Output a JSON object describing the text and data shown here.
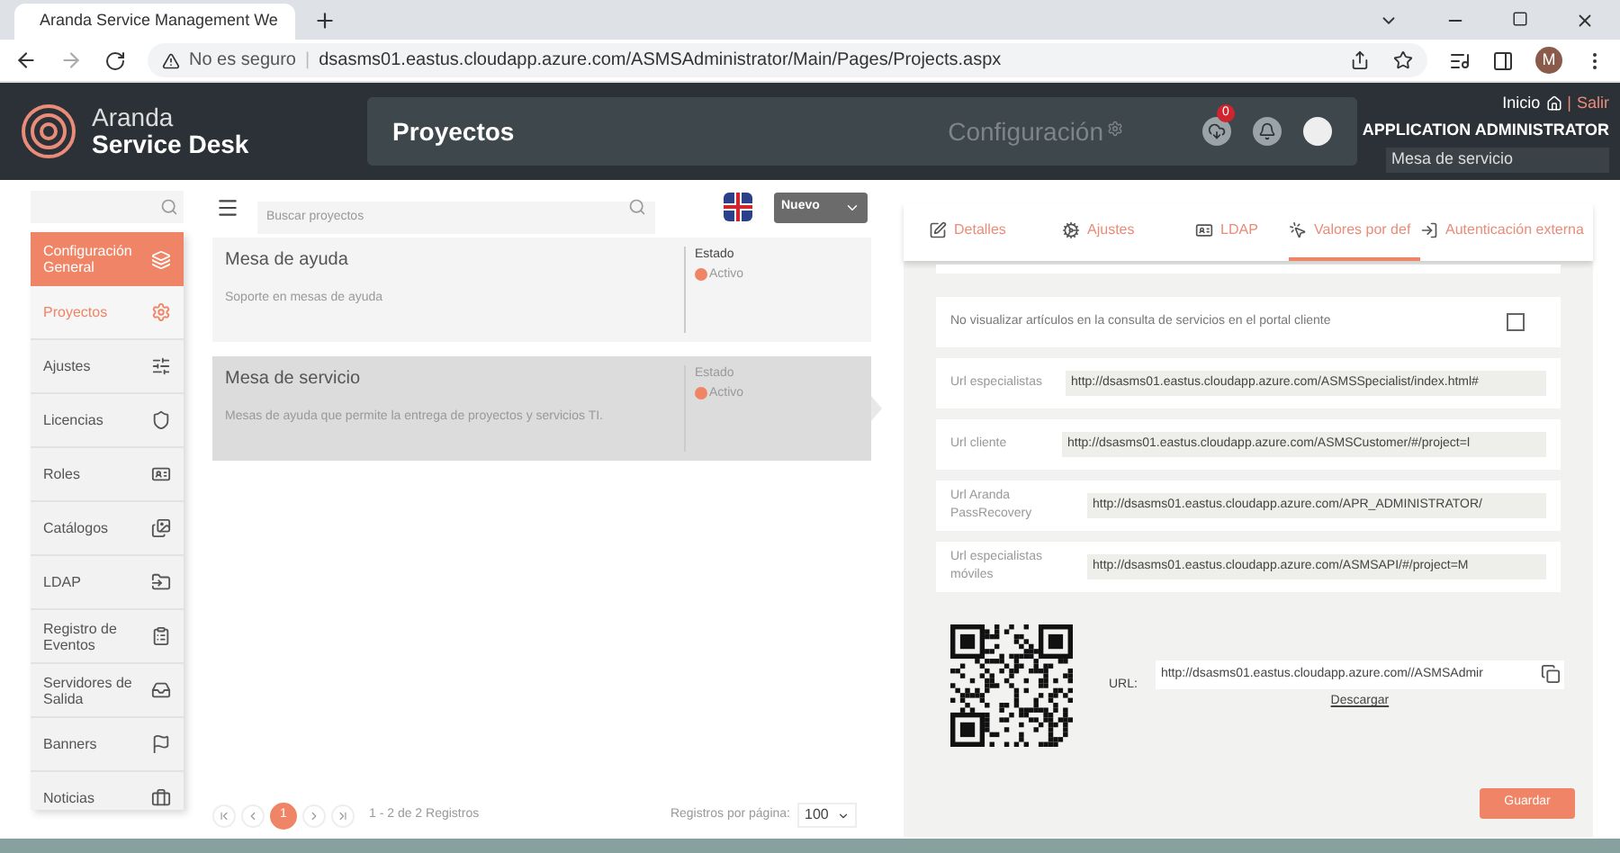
{
  "browser": {
    "tab_title": "Aranda Service Management We",
    "security": "No es seguro",
    "separator": "|",
    "url": "dsasms01.eastus.cloudapp.azure.com/ASMSAdministrator/Main/Pages/Projects.aspx",
    "profile": "M"
  },
  "header": {
    "brand_line1": "Aranda",
    "brand_line2": "Service Desk",
    "page_title": "Proyectos",
    "section": "Configuración",
    "notifications_badge": "0",
    "home": "Inicio",
    "separator": "|",
    "logout": "Salir",
    "user": "APPLICATION ADMINISTRATOR",
    "project": "Mesa de servicio"
  },
  "sidebar": {
    "section": {
      "label": "Configuración General"
    },
    "items": [
      {
        "label": "Proyectos",
        "selected": true
      },
      {
        "label": "Ajustes",
        "selected": false
      },
      {
        "label": "Licencias",
        "selected": false
      },
      {
        "label": "Roles",
        "selected": false
      },
      {
        "label": "Catálogos",
        "selected": false
      },
      {
        "label": "LDAP",
        "selected": false
      },
      {
        "label": "Registro de Eventos",
        "selected": false
      },
      {
        "label": "Servidores de Salida",
        "selected": false
      },
      {
        "label": "Banners",
        "selected": false
      },
      {
        "label": "Noticias",
        "selected": false
      }
    ]
  },
  "projects": {
    "search_placeholder": "Buscar proyectos",
    "new_button": "Nuevo",
    "items": [
      {
        "name": "Mesa de ayuda",
        "description": "Soporte en mesas de ayuda",
        "status_label": "Estado",
        "status": "Activo",
        "selected": false
      },
      {
        "name": "Mesa de servicio",
        "description": "Mesas de ayuda que permite la entrega de proyectos y servicios TI.",
        "status_label": "Estado",
        "status": "Activo",
        "selected": true
      }
    ],
    "pagination": {
      "current_page": "1",
      "summary": "1 - 2 de 2 Registros",
      "per_page_label": "Registros por página:",
      "per_page": "100"
    }
  },
  "detail": {
    "tabs": [
      {
        "label": "Detalles",
        "selected": false
      },
      {
        "label": "Ajustes",
        "selected": false
      },
      {
        "label": "LDAP",
        "selected": false
      },
      {
        "label": "Valores por def",
        "selected": true
      },
      {
        "label": "Autenticación externa",
        "selected": false
      }
    ],
    "hide_articles": {
      "label": "No visualizar artículos en la consulta de servicios en el portal cliente",
      "checked": false
    },
    "urls": [
      {
        "label": "Url especialistas",
        "value": "http://dsasms01.eastus.cloudapp.azure.com/ASMSSpecialist/index.html#"
      },
      {
        "label": "Url cliente",
        "value": "http://dsasms01.eastus.cloudapp.azure.com/ASMSCustomer/#/project=l"
      },
      {
        "label": "Url Aranda PassRecovery",
        "value": "http://dsasms01.eastus.cloudapp.azure.com/APR_ADMINISTRATOR/"
      },
      {
        "label": "Url especialistas móviles",
        "value": "http://dsasms01.eastus.cloudapp.azure.com/ASMSAPI/#/project=M"
      }
    ],
    "qr": {
      "url_label": "URL:",
      "url": "http://dsasms01.eastus.cloudapp.azure.com//ASMSAdmir",
      "download": "Descargar"
    },
    "save_button": "Guardar"
  }
}
